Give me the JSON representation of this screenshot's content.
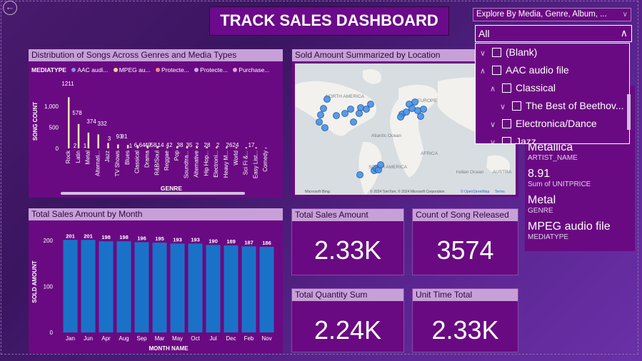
{
  "title": "TRACK SALES DASHBOARD",
  "genre_panel": {
    "header": "Distribution of Songs Across Genres and Media Types",
    "legend_title": "MEDIATYPE",
    "legend": [
      {
        "label": "AAC audi...",
        "color": "#8a8af0"
      },
      {
        "label": "MPEG au...",
        "color": "#f0d890"
      },
      {
        "label": "Protecte...",
        "color": "#f08a7a"
      },
      {
        "label": "Protecte...",
        "color": "#c8a8f0"
      },
      {
        "label": "Purchase...",
        "color": "#e0a0e0"
      }
    ]
  },
  "map_panel": {
    "header": "Sold Amount Summarized by Location",
    "labels": [
      "NORTH AMERICA",
      "EUROPE",
      "Atlantic Ocean",
      "AFRICA",
      "SOUTH AMERICA",
      "Indian Ocean",
      "AUSTRA"
    ],
    "brand": "Microsoft Bing",
    "credit": "© 2024 TomTom, © 2024 Microsoft Corporation",
    "credit_link": "© OpenStreetMap",
    "terms": "Terms"
  },
  "month_panel": {
    "header": "Total Sales Amount by Month"
  },
  "cards": [
    {
      "label": "Total Sales Amount",
      "value": "2.33K"
    },
    {
      "label": "Count of Song Released",
      "value": "3574"
    },
    {
      "label": "Total Quantity Sum",
      "value": "2.24K"
    },
    {
      "label": "Unit Time Total",
      "value": "2.33K"
    }
  ],
  "info_panel": [
    {
      "value": "Metallica",
      "label": "ARTIST_NAME"
    },
    {
      "value": "8.91",
      "label": "Sum of UNITPRICE"
    },
    {
      "value": "Metal",
      "label": "GENRE"
    },
    {
      "value": "MPEG audio file",
      "label": "MEDIATYPE"
    }
  ],
  "slicer": {
    "title": "Explore By Media, Genre, Album, ...",
    "selected": "All",
    "items": [
      {
        "label": "(Blank)"
      },
      {
        "label": "AAC audio file"
      },
      {
        "label": "Classical"
      },
      {
        "label": "The Best of Beethov..."
      },
      {
        "label": "Electronica/Dance"
      },
      {
        "label": "Jazz"
      }
    ]
  },
  "chart_data": [
    {
      "type": "bar",
      "title": "Distribution of Songs Across Genres and Media Types",
      "xlabel": "GENRE",
      "ylabel": "SONG COUNT",
      "yticks": [
        "0",
        "500",
        "1,000"
      ],
      "ylim": [
        0,
        1300
      ],
      "categories": [
        "Rock",
        "Latin",
        "Metal",
        "Alternati...",
        "Jazz",
        "TV Shows",
        "Blues",
        "Classical",
        "Drama",
        "R&B/Soul",
        "Reggae",
        "Pop",
        "Soundtra...",
        "Alternative",
        "Hip Hop...",
        "Electroni...",
        "Heavy M...",
        "World",
        "Sci Fi &...",
        "Easy List...",
        "Comedy"
      ],
      "series_labels": [
        "1211",
        "2",
        "578",
        "1",
        "374",
        "332",
        "3",
        "93",
        "81",
        "1",
        "6",
        "64",
        "49",
        "58",
        "14",
        "42",
        "38",
        "35",
        "2",
        "28",
        "2",
        "26",
        "24",
        "17"
      ],
      "values": [
        1211,
        578,
        374,
        332,
        130,
        93,
        81,
        74,
        64,
        58,
        30,
        48,
        43,
        40,
        35,
        30,
        28,
        28,
        26,
        24,
        17
      ],
      "legend": [
        "AAC audi...",
        "MPEG au...",
        "Protecte...",
        "Protecte...",
        "Purchase..."
      ],
      "legend_title": "MEDIATYPE"
    },
    {
      "type": "bar",
      "title": "Total Sales Amount by Month",
      "xlabel": "MONTH NAME",
      "ylabel": "SOLD AMOUNT",
      "yticks": [
        "0",
        "100",
        "200"
      ],
      "ylim": [
        0,
        220
      ],
      "categories": [
        "Jan",
        "Jun",
        "Apr",
        "Aug",
        "Sep",
        "Mar",
        "May",
        "Oct",
        "Jul",
        "Dec",
        "Feb",
        "Nov"
      ],
      "values": [
        201,
        201,
        198,
        198,
        196,
        195,
        193,
        193,
        190,
        189,
        187,
        186
      ],
      "color": "#1a72c8"
    }
  ]
}
